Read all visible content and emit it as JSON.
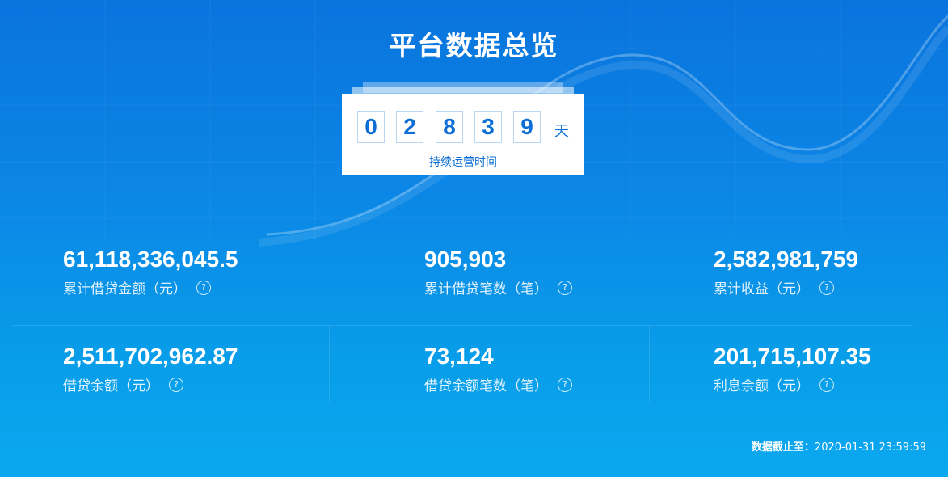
{
  "page": {
    "title": "平台数据总览"
  },
  "counter": {
    "digits": [
      "0",
      "2",
      "8",
      "3",
      "9"
    ],
    "unit": "天",
    "label": "持续运营时间"
  },
  "stats": [
    {
      "value": "61,118,336,045.5",
      "label": "累计借贷金额（元）"
    },
    {
      "value": "905,903",
      "label": "累计借贷笔数（笔）"
    },
    {
      "value": "2,582,981,759",
      "label": "累计收益（元）"
    },
    {
      "value": "2,511,702,962.87",
      "label": "借贷余额（元）"
    },
    {
      "value": "73,124",
      "label": "借贷余额笔数（笔）"
    },
    {
      "value": "201,715,107.35",
      "label": "利息余额（元）"
    }
  ],
  "footer": {
    "label": "数据截止至：",
    "datetime": "2020-01-31 23:59:59"
  },
  "colors": {
    "background_top": "#0a74dd",
    "background_bottom": "#0aa8ef",
    "accent": "#0d6fd6"
  },
  "icons": {
    "help": "question-circle-icon"
  }
}
